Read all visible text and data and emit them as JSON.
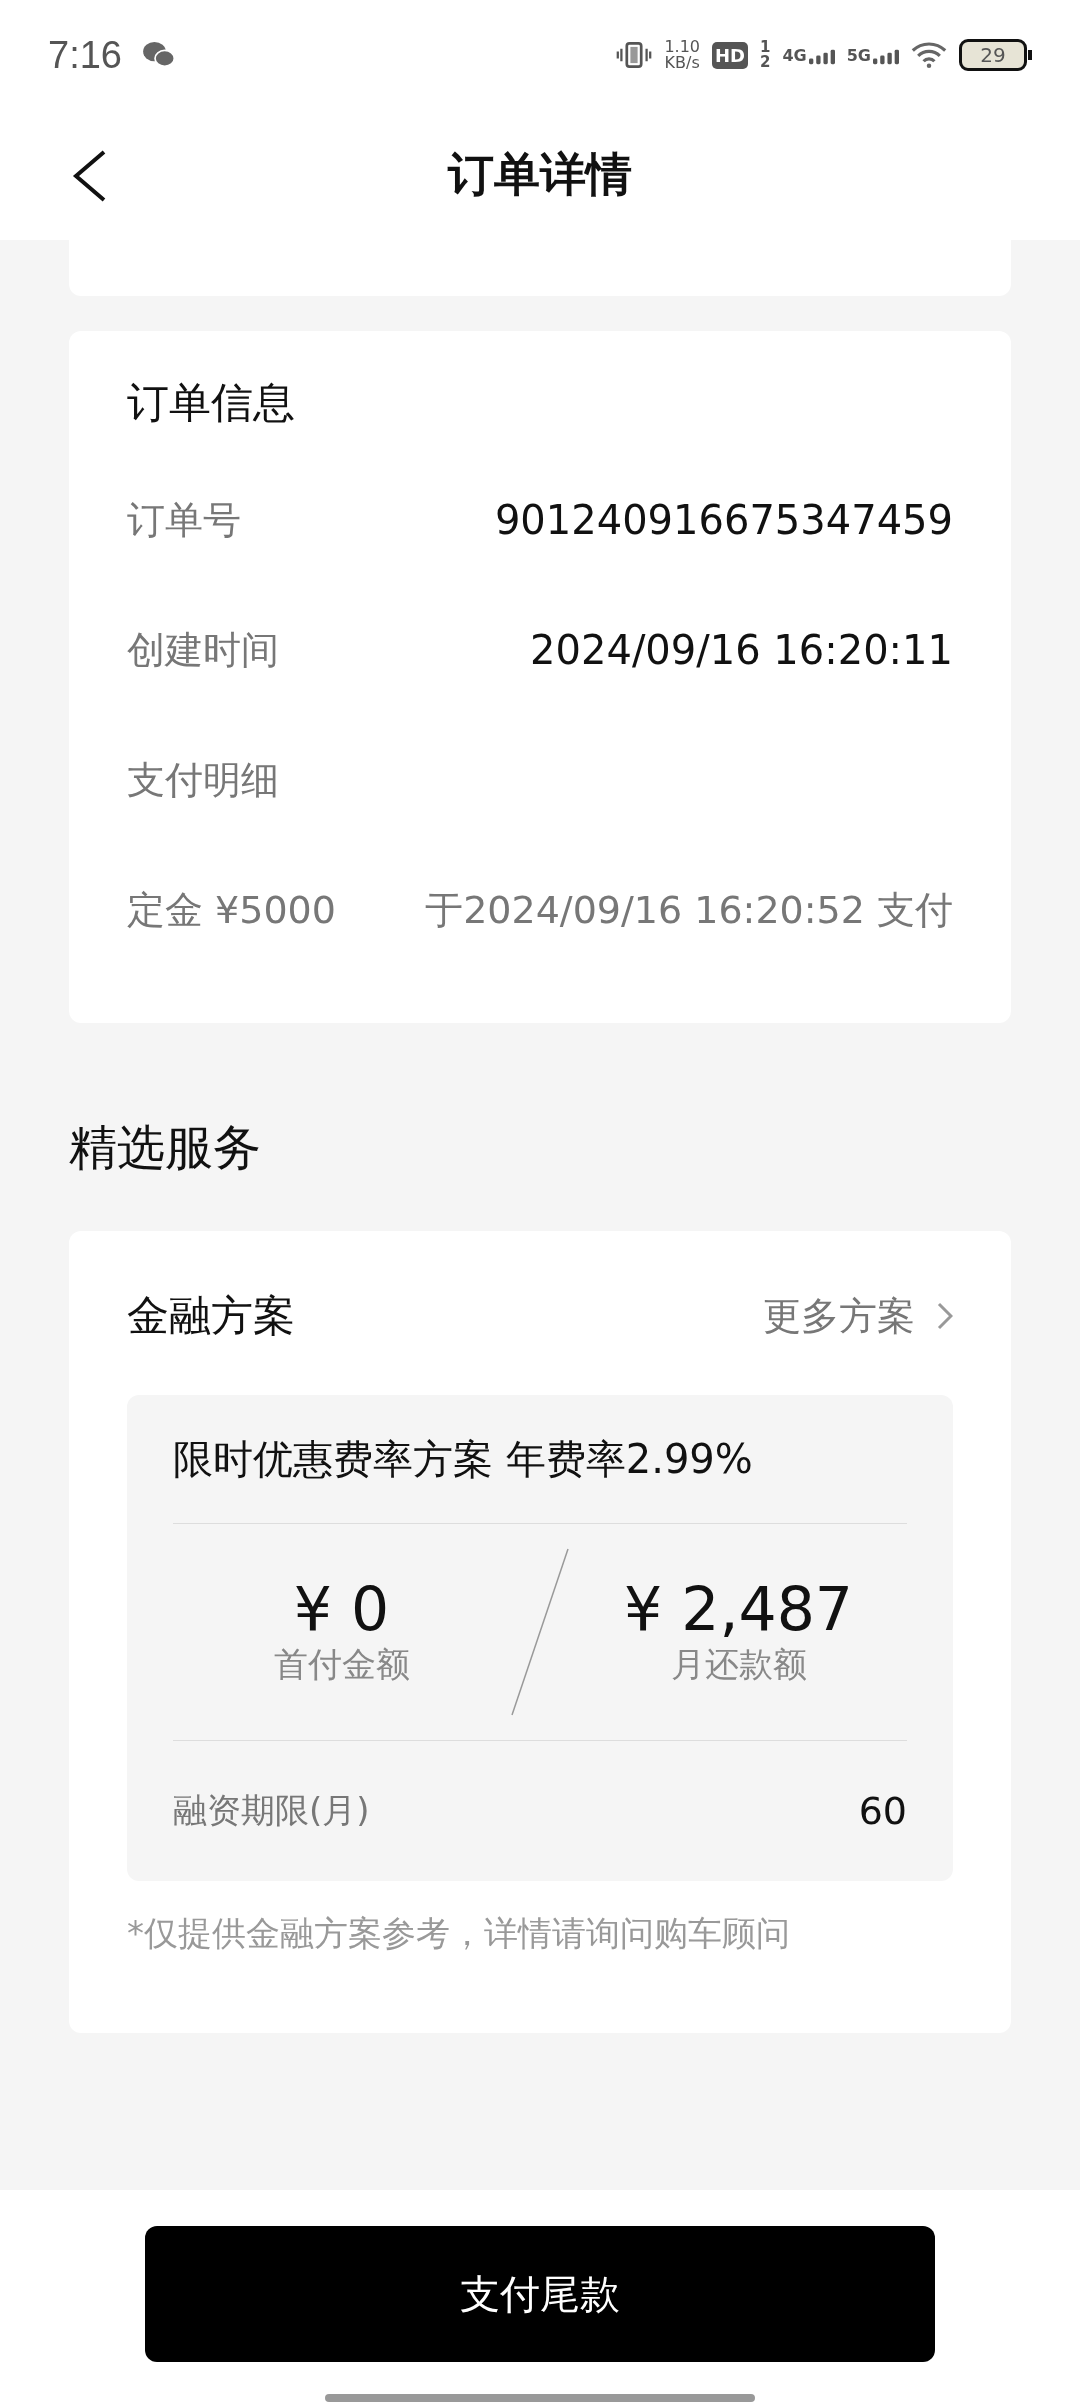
{
  "status_bar": {
    "time": "7:16",
    "speed_value": "1.10",
    "speed_unit": "KB/s",
    "hd": "HD",
    "sims": [
      "1",
      "2"
    ],
    "networks": [
      "4G",
      "5G"
    ],
    "battery": "29"
  },
  "header": {
    "title": "订单详情"
  },
  "order_info": {
    "title": "订单信息",
    "rows": [
      {
        "label": "订单号",
        "value": "901240916675347459"
      },
      {
        "label": "创建时间",
        "value": "2024/09/16 16:20:11"
      },
      {
        "label": "支付明细",
        "value": ""
      },
      {
        "label": "定金 ¥5000",
        "value": "于2024/09/16 16:20:52 支付"
      }
    ]
  },
  "services": {
    "title": "精选服务",
    "finance": {
      "title": "金融方案",
      "more": "更多方案",
      "plan": {
        "name": "限时优惠费率方案 年费率2.99%",
        "amounts": [
          {
            "value": "¥ 0",
            "label": "首付金额"
          },
          {
            "value": "¥ 2,487",
            "label": "月还款额"
          }
        ],
        "term_label": "融资期限(月)",
        "term_value": "60"
      },
      "note": "*仅提供金融方案参考，详情请询问购车顾问"
    }
  },
  "footer": {
    "button": "支付尾款"
  }
}
